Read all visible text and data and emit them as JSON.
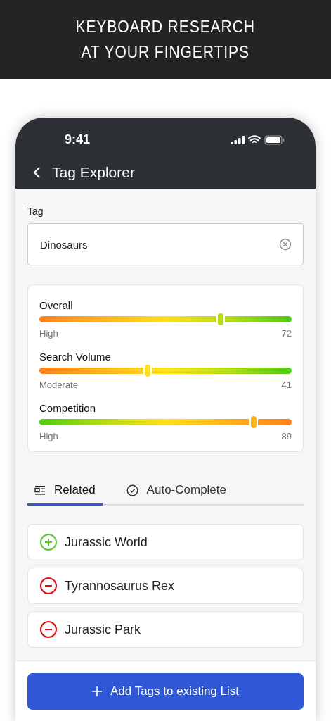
{
  "banner": {
    "lines": [
      "KEYBOARD RESEARCH",
      "AT YOUR FINGERTIPS"
    ]
  },
  "status_bar": {
    "time": "9:41"
  },
  "nav": {
    "title": "Tag Explorer"
  },
  "tag_field": {
    "label": "Tag",
    "value": "Dinosaurs"
  },
  "metrics": [
    {
      "name": "Overall",
      "kind": "rising",
      "level": 0.72,
      "rating": "High",
      "reading": "72"
    },
    {
      "name": "Search Volume",
      "kind": "rising",
      "level": 0.43,
      "rating": "Moderate",
      "reading": "41"
    },
    {
      "name": "Competition",
      "kind": "falling",
      "level": 0.85,
      "rating": "High",
      "reading": "89"
    }
  ],
  "tabs": [
    {
      "label": "Related",
      "selected": true
    },
    {
      "label": "Auto-Complete",
      "selected": false
    }
  ],
  "tags": [
    {
      "label": "Jurassic World",
      "kind": "add"
    },
    {
      "label": "Tyrannosaurus Rex",
      "kind": "remove"
    },
    {
      "label": "Jurassic Park",
      "kind": "remove"
    }
  ],
  "action_button": {
    "label": "Add Tags to existing List"
  }
}
